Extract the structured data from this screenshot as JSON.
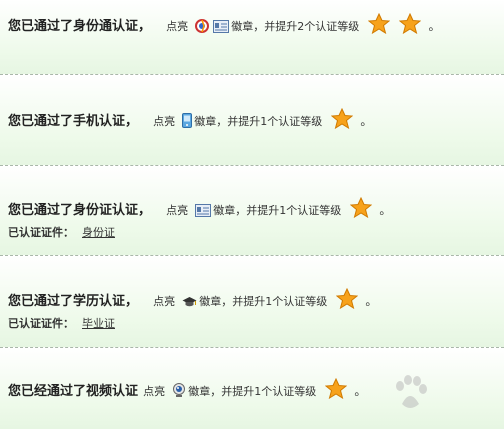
{
  "rows": [
    {
      "title": "您已通过了身份通认证",
      "comma": "，",
      "light_prefix": "点亮",
      "light_suffix": "徽章，并提升2个认证等级",
      "period": "。"
    },
    {
      "title": "您已通过了手机认证",
      "comma": "，",
      "light_prefix": "点亮",
      "light_suffix": "徽章，并提升1个认证等级",
      "period": "。"
    },
    {
      "title": "您已通过了身份证认证",
      "comma": "，",
      "light_prefix": "点亮",
      "light_suffix": "徽章，并提升1个认证等级",
      "period": "。",
      "doc_label": "已认证证件：",
      "doc_value": "身份证"
    },
    {
      "title": "您已通过了学历认证",
      "comma": "，",
      "light_prefix": "点亮",
      "light_suffix": "徽章，并提升1个认证等级",
      "period": "。",
      "doc_label": "已认证证件：",
      "doc_value": "毕业证"
    },
    {
      "title": "您已经通过了视频认证",
      "light_prefix": "点亮",
      "light_suffix": "徽章，并提升1个认证等级",
      "period": "。"
    }
  ],
  "icons": {
    "star": "star-icon",
    "identity_badge": "identity-badge-icon",
    "id_card": "id-card-icon",
    "phone": "mobile-phone-icon",
    "graduation_cap": "graduation-cap-icon",
    "webcam": "webcam-icon",
    "watermark": "baidu-paw-logo"
  },
  "colors": {
    "star": "#f7a21b",
    "panel_bottom": "#e6f6e2",
    "divider": "#a9b7a9"
  }
}
